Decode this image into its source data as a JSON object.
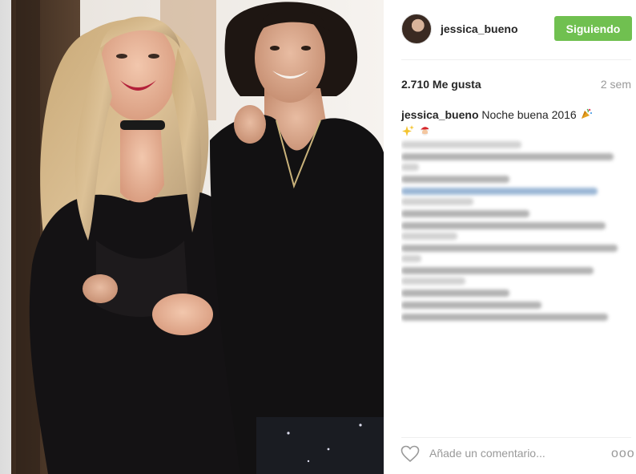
{
  "post": {
    "author": {
      "username": "jessica_bueno"
    },
    "follow_button_label": "Siguiendo",
    "likes_label": "2.710 Me gusta",
    "age_label": "2 sem",
    "caption": {
      "username": "jessica_bueno",
      "text": "Noche buena 2016",
      "emojis": [
        "party-popper",
        "sparkles",
        "santa"
      ]
    },
    "comment_box": {
      "placeholder": "Añade un comentario..."
    },
    "more_label": "ooo"
  },
  "colors": {
    "follow_button": "#70c050",
    "muted_text": "#999999",
    "divider": "#efefef"
  }
}
